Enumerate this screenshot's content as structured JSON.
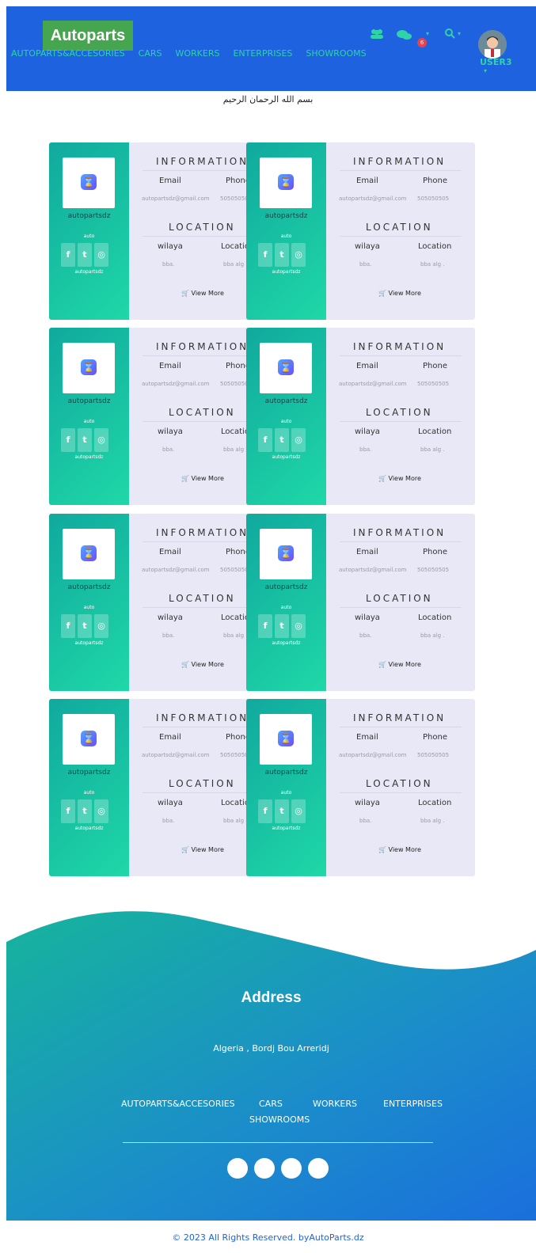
{
  "header": {
    "brand": "Autoparts",
    "nav": [
      "AUTOPARTS&ACCESORIES",
      "CARS",
      "WORKERS",
      "ENTERPRISES",
      "SHOWROOMS"
    ],
    "notification_count": "6",
    "user": "USER3"
  },
  "bismillah": "بسم الله الرحمان الرحيم",
  "card": {
    "information_title": "INFORMATION",
    "email_label": "Email",
    "phone_label": "Phone",
    "email_value": "autopartsdz@gmail.com",
    "phone_value": "505050505",
    "location_title": "LOCATION",
    "wilaya_label": "wilaya",
    "location_label": "Location",
    "wilaya_value": "bba.",
    "location_value": "bba alg .",
    "name": "autopartsdz",
    "type": "auto",
    "sub": "autopartsdz",
    "view_more": "View More"
  },
  "footer": {
    "address_title": "Address",
    "address_text": "Algeria , Bordj Bou Arreridj",
    "nav": [
      "AUTOPARTS&ACCESORIES",
      "CARS",
      "WORKERS",
      "ENTERPRISES",
      "SHOWROOMS"
    ],
    "copyright": "© 2023 All Rights Reserved. byAutoParts.dz"
  },
  "colors": {
    "header_bg": "#1f62df",
    "accent": "#2ed3a8",
    "brand_bg": "#46a54f",
    "card_bg": "#e9e8f6"
  }
}
